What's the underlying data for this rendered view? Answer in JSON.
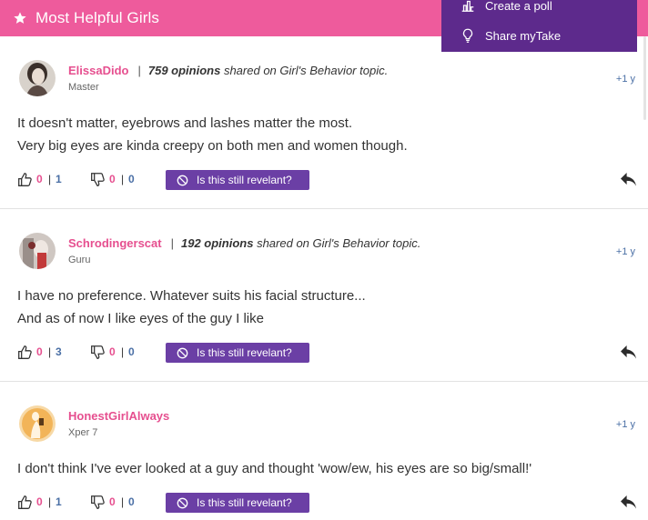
{
  "header": {
    "title": "Most Helpful Girls",
    "icon": "star-icon",
    "color": "#ee5b9c"
  },
  "dropdown": {
    "items": [
      {
        "label": "Create a poll",
        "icon": "bar-chart-icon"
      },
      {
        "label": "Share myTake",
        "icon": "lightbulb-icon"
      }
    ]
  },
  "opinions": [
    {
      "user": "ElissaDido",
      "level": "Master",
      "opinions_count": "759 opinions",
      "shared": "shared on Girl's Behavior topic.",
      "time": "+1 y",
      "lines": [
        "It doesn't matter, eyebrows and lashes matter the most.",
        "Very big eyes are kinda creepy on both men and women though."
      ],
      "up_count": "0",
      "up_total": "1",
      "down_count": "0",
      "down_total": "0",
      "relevant_label": "Is this still revelant?"
    },
    {
      "user": "Schrodingerscat",
      "level": "Guru",
      "opinions_count": "192 opinions",
      "shared": "shared on Girl's Behavior topic.",
      "time": "+1 y",
      "lines": [
        "I have no preference. Whatever suits his facial structure...",
        "And as of now I like eyes of the guy I like"
      ],
      "up_count": "0",
      "up_total": "3",
      "down_count": "0",
      "down_total": "0",
      "relevant_label": "Is this still revelant?"
    },
    {
      "user": "HonestGirlAlways",
      "level": "Xper 7",
      "time": "+1 y",
      "lines": [
        "I don't think I've ever looked at a guy and thought 'wow/ew, his eyes are so big/small!'"
      ],
      "up_count": "0",
      "up_total": "1",
      "down_count": "0",
      "down_total": "0",
      "relevant_label": "Is this still revelant?"
    }
  ],
  "icons": {
    "upvote": "thumbs-up-icon",
    "downvote": "thumbs-down-icon",
    "relevant": "ban-icon",
    "reply": "reply-icon"
  },
  "colors": {
    "pink": "#e64f8f",
    "purple": "#6b3fa5",
    "dark_purple": "#5d2a8c",
    "blue": "#4a6fa5"
  }
}
